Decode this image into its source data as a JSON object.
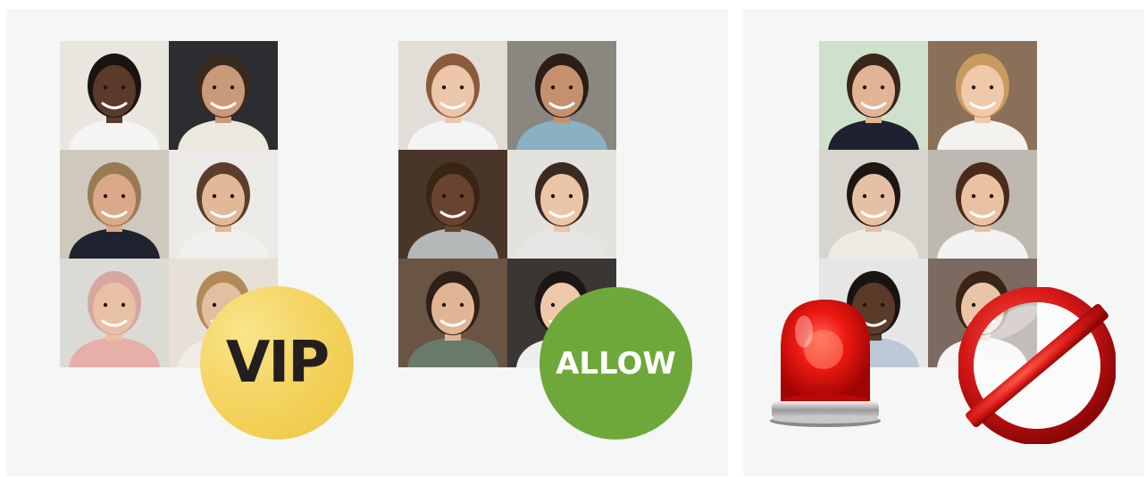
{
  "badges": {
    "vip_label": "VIP",
    "allow_label": "ALLOW"
  },
  "colors": {
    "panel_bg": "#f5f6f6",
    "vip_yellow": "#f4d463",
    "allow_green": "#6fa83a",
    "alarm_red": "#e01010",
    "no_entry_red": "#d41616"
  },
  "icons": {
    "alarm": "red-siren-icon",
    "prohibited": "no-entry-icon"
  },
  "grids": [
    {
      "name": "vip-group",
      "photos": 6
    },
    {
      "name": "allow-group",
      "photos": 6
    },
    {
      "name": "blocked-group",
      "photos": 6
    }
  ]
}
